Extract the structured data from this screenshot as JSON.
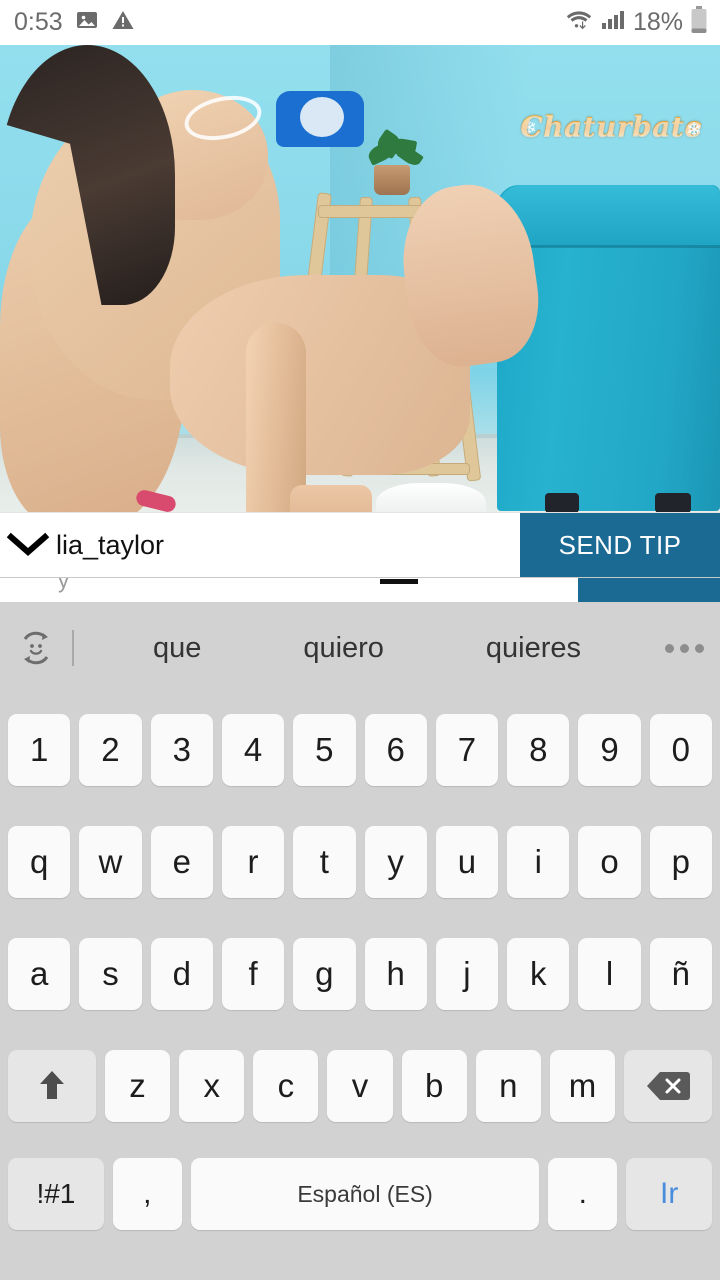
{
  "status_bar": {
    "time": "0:53",
    "battery_percent": "18%",
    "icons": [
      "image-icon",
      "warning-icon",
      "wifi-icon",
      "signal-icon",
      "battery-icon"
    ]
  },
  "video": {
    "watermark": "Chaturbate",
    "snowflake_glyph": "❄",
    "scene_colors": {
      "wall": "#8ad9ea",
      "sofa": "#22a7c6",
      "wood": "#dfc79a",
      "pineapple": "#efd63f",
      "floor": "#e2e9e6",
      "skin": "#e7c2a4"
    }
  },
  "user_bar": {
    "chevron": "chevron-down-icon",
    "username": "lia_taylor",
    "send_tip_label": "SEND TIP",
    "accent_color": "#1b6a94"
  },
  "chat_row": {
    "cut_off_placeholder": "y"
  },
  "keyboard": {
    "language_label": "Español (ES)",
    "suggestion_icon": "emoji-sticker-toggle-icon",
    "overflow_icon": "more-options-icon",
    "suggestions": [
      "que",
      "quiero",
      "quieres"
    ],
    "rows": {
      "numbers": [
        "1",
        "2",
        "3",
        "4",
        "5",
        "6",
        "7",
        "8",
        "9",
        "0"
      ],
      "top": [
        "q",
        "w",
        "e",
        "r",
        "t",
        "y",
        "u",
        "i",
        "o",
        "p"
      ],
      "home": [
        "a",
        "s",
        "d",
        "f",
        "g",
        "h",
        "j",
        "k",
        "l",
        "ñ"
      ],
      "bottom": [
        "z",
        "x",
        "c",
        "v",
        "b",
        "n",
        "m"
      ]
    },
    "special_keys": {
      "shift": "shift-icon",
      "backspace": "backspace-icon",
      "symbols": "!#1",
      "comma": ",",
      "period": ".",
      "enter": "Ir"
    },
    "enter_color": "#4a8ddc",
    "background_color": "#d2d2d2",
    "key_color": "#fafafa"
  }
}
